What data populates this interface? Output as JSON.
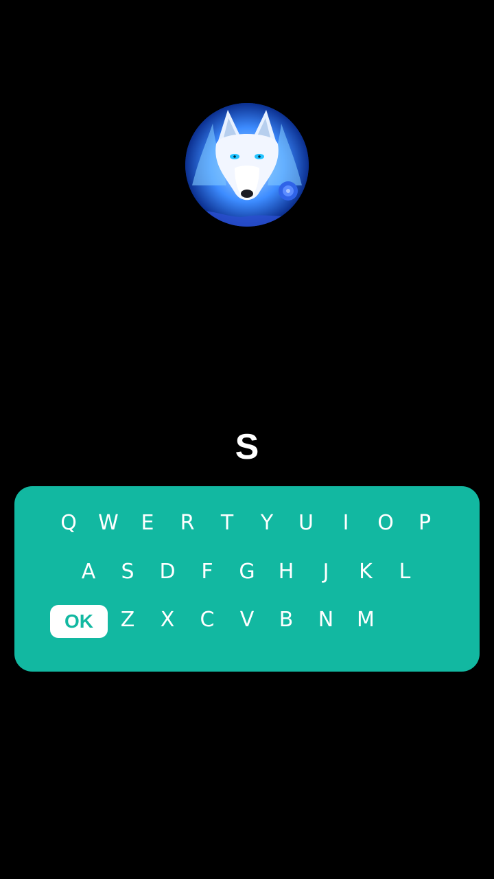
{
  "profile": {
    "avatar_description": "wolf-avatar"
  },
  "input": {
    "value": "S"
  },
  "keyboard": {
    "row1": [
      "Q",
      "W",
      "E",
      "R",
      "T",
      "Y",
      "U",
      "I",
      "O",
      "P"
    ],
    "row2": [
      "A",
      "S",
      "D",
      "F",
      "G",
      "H",
      "J",
      "K",
      "L"
    ],
    "row3": [
      "Z",
      "X",
      "C",
      "V",
      "B",
      "N",
      "M"
    ],
    "ok_label": "OK"
  },
  "colors": {
    "background": "#000000",
    "keyboard": "#12b8a1",
    "ok_key_background": "#ffffff",
    "text": "#ffffff"
  }
}
